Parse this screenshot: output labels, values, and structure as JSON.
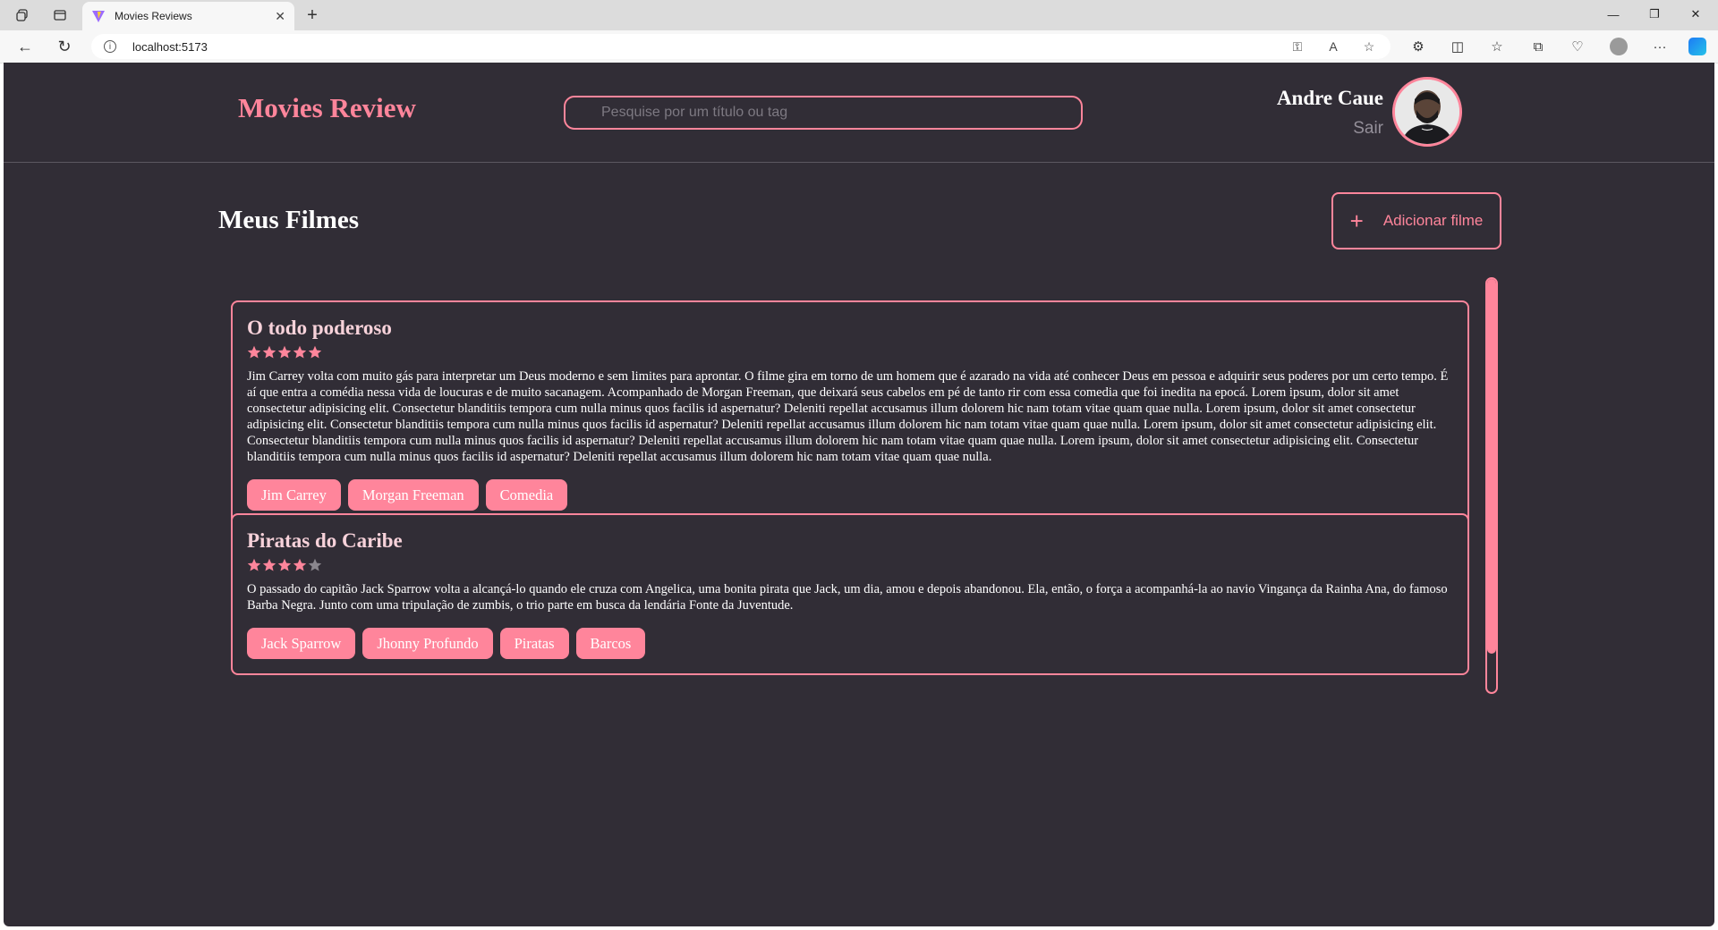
{
  "browser": {
    "tab_title": "Movies Reviews",
    "url": "localhost:5173"
  },
  "header": {
    "brand": "Movies Review",
    "search_placeholder": "Pesquise por um título ou tag",
    "user_name": "Andre Caue",
    "logout_label": "Sair"
  },
  "main": {
    "title": "Meus Filmes",
    "add_button_label": "Adicionar filme",
    "movies": [
      {
        "title": "O todo poderoso",
        "rating": 5,
        "description": "Jim Carrey volta com muito gás para interpretar um Deus moderno e sem limites para aprontar. O filme gira em torno de um homem que é azarado na vida até conhecer Deus em pessoa e adquirir seus poderes por um certo tempo. É aí que entra a comédia nessa vida de loucuras e de muito sacanagem. Acompanhado de Morgan Freeman, que deixará seus cabelos em pé de tanto rir com essa comedia que foi inedita na epocá. Lorem ipsum, dolor sit amet consectetur adipisicing elit. Consectetur blanditiis tempora cum nulla minus quos facilis id aspernatur? Deleniti repellat accusamus illum dolorem hic nam totam vitae quam quae nulla. Lorem ipsum, dolor sit amet consectetur adipisicing elit. Consectetur blanditiis tempora cum nulla minus quos facilis id aspernatur? Deleniti repellat accusamus illum dolorem hic nam totam vitae quam quae nulla. Lorem ipsum, dolor sit amet consectetur adipisicing elit. Consectetur blanditiis tempora cum nulla minus quos facilis id aspernatur? Deleniti repellat accusamus illum dolorem hic nam totam vitae quam quae nulla. Lorem ipsum, dolor sit amet consectetur adipisicing elit. Consectetur blanditiis tempora cum nulla minus quos facilis id aspernatur? Deleniti repellat accusamus illum dolorem hic nam totam vitae quam quae nulla.",
        "tags": [
          "Jim Carrey",
          "Morgan Freeman",
          "Comedia"
        ]
      },
      {
        "title": "Piratas do Caribe",
        "rating": 4,
        "description": "O passado do capitão Jack Sparrow volta a alcançá-lo quando ele cruza com Angelica, uma bonita pirata que Jack, um dia, amou e depois abandonou. Ela, então, o força a acompanhá-la ao navio Vingança da Rainha Ana, do famoso Barba Negra. Junto com uma tripulação de zumbis, o trio parte em busca da lendária Fonte da Juventude.",
        "tags": [
          "Jack Sparrow",
          "Jhonny Profundo",
          "Piratas",
          "Barcos"
        ]
      }
    ]
  },
  "colors": {
    "accent": "#ff859b",
    "background": "#312d36",
    "star_empty": "#8a868e"
  }
}
